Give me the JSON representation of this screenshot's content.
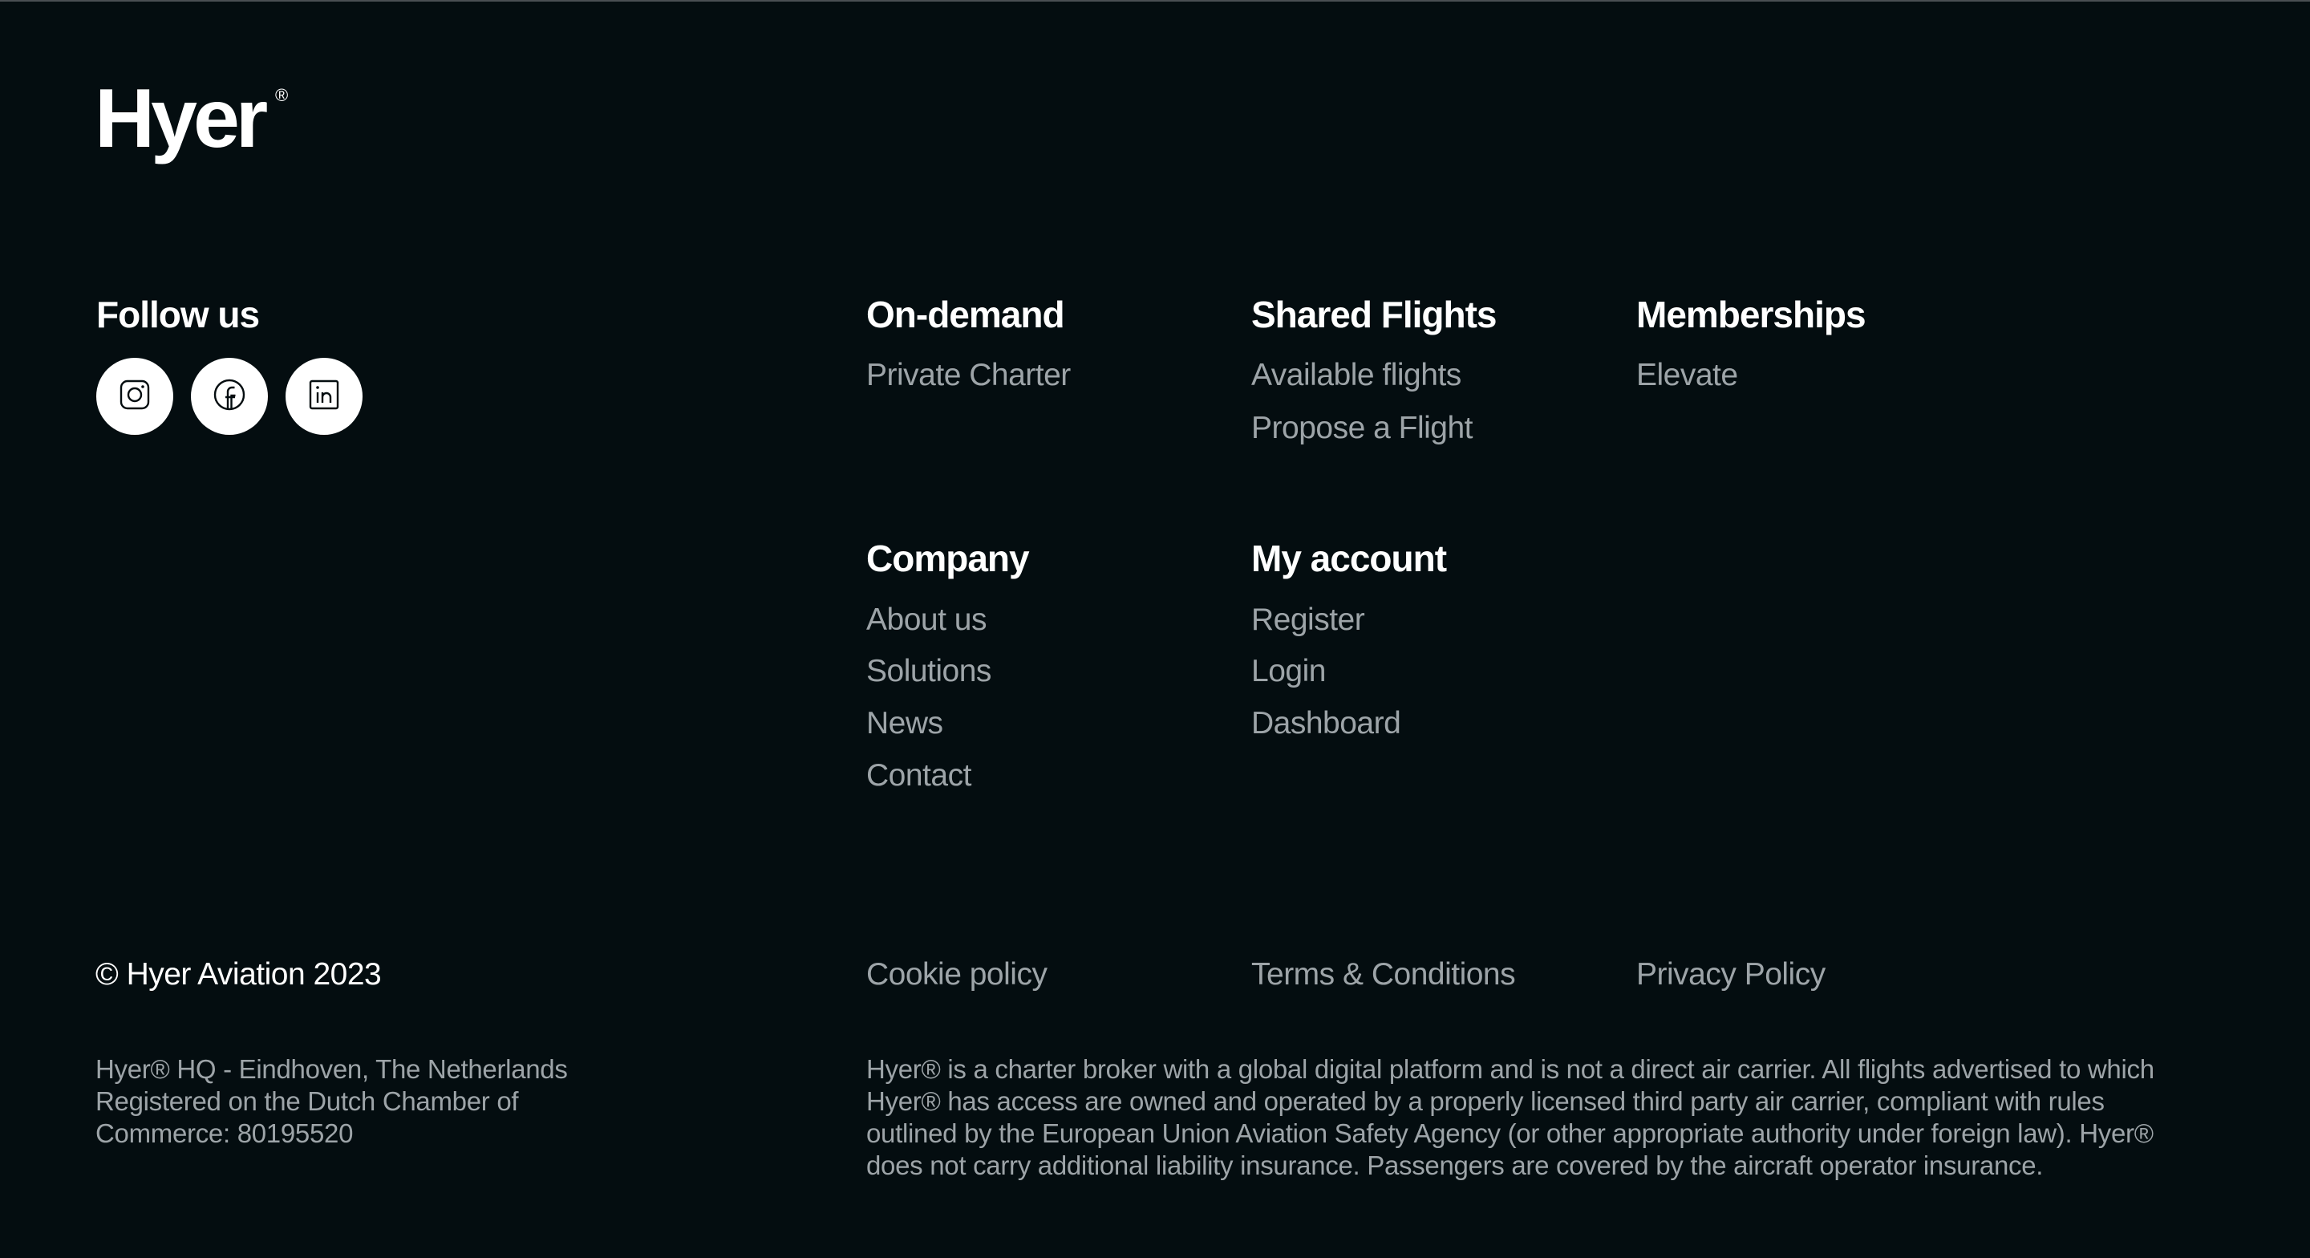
{
  "brand": {
    "name": "Hyer",
    "reg_mark": "®"
  },
  "social": {
    "heading": "Follow us",
    "links": [
      {
        "name": "instagram",
        "icon": "instagram-icon"
      },
      {
        "name": "facebook",
        "icon": "facebook-icon"
      },
      {
        "name": "linkedin",
        "icon": "linkedin-icon"
      }
    ]
  },
  "nav": {
    "on_demand": {
      "heading": "On-demand",
      "items": [
        "Private Charter"
      ]
    },
    "shared_flights": {
      "heading": "Shared Flights",
      "items": [
        "Available flights",
        "Propose a Flight"
      ]
    },
    "memberships": {
      "heading": "Memberships",
      "items": [
        "Elevate"
      ]
    },
    "company": {
      "heading": "Company",
      "items": [
        "About us",
        "Solutions",
        "News",
        "Contact"
      ]
    },
    "my_account": {
      "heading": "My account",
      "items": [
        "Register",
        "Login",
        "Dashboard"
      ]
    }
  },
  "legal": {
    "copyright": "© Hyer Aviation 2023",
    "links": [
      "Cookie policy",
      "Terms & Conditions",
      "Privacy Policy"
    ],
    "address_lines": [
      "Hyer® HQ - Eindhoven, The Netherlands",
      "Registered on the Dutch Chamber of",
      "Commerce: 80195520"
    ],
    "disclaimer_lines": [
      "Hyer® is a charter broker with a global digital platform and is not a direct air carrier. All flights advertised to which",
      "Hyer® has access are owned and operated by a properly licensed third party air carrier, compliant with rules",
      "outlined by the European Union Aviation Safety Agency (or other appropriate authority under foreign law). Hyer®",
      "does not carry additional liability insurance. Passengers are covered by the aircraft operator insurance."
    ]
  },
  "colors": {
    "background": "#040d10",
    "heading": "#ffffff",
    "link": "#9da4a8"
  }
}
